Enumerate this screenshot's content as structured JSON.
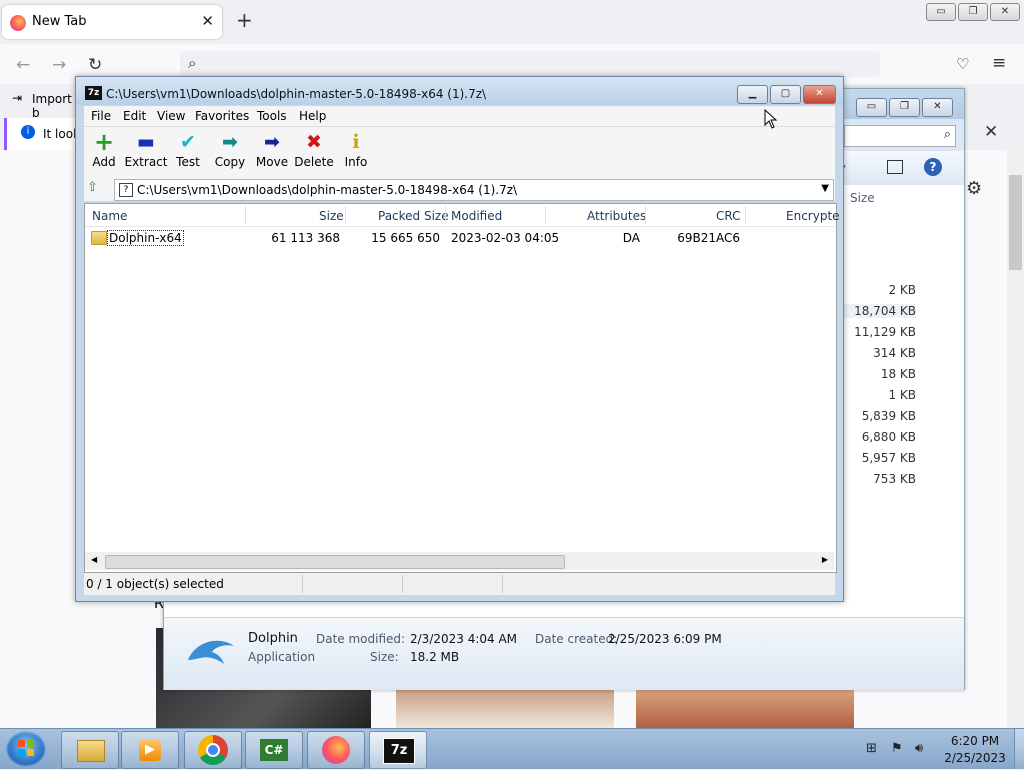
{
  "browser": {
    "tab_title": "New Tab",
    "tab_close": "✕",
    "new_tab": "+",
    "import_label": "Import b",
    "notice_text": "It look",
    "window_controls": {
      "minimize": "▭",
      "restore": "❐",
      "close": "✕"
    }
  },
  "explorer": {
    "column_size": "Size",
    "sizes": [
      "2 KB",
      "18,704 KB",
      "11,129 KB",
      "314 KB",
      "18 KB",
      "1 KB",
      "5,839 KB",
      "6,880 KB",
      "5,957 KB",
      "753 KB"
    ],
    "details": {
      "name": "Dolphin",
      "type": "Application",
      "date_modified_label": "Date modified:",
      "date_modified": "2/3/2023 4:04 AM",
      "size_label": "Size:",
      "size": "18.2 MB",
      "date_created_label": "Date created:",
      "date_created": "2/25/2023 6:09 PM"
    },
    "partial_letter": "R"
  },
  "sevenzip": {
    "title": "C:\\Users\\vm1\\Downloads\\dolphin-master-5.0-18498-x64 (1).7z\\",
    "icon_text": "7z",
    "menu": [
      "File",
      "Edit",
      "View",
      "Favorites",
      "Tools",
      "Help"
    ],
    "toolbar": [
      {
        "label": "Add",
        "icon": "+",
        "color": "#1fa31f"
      },
      {
        "label": "Extract",
        "icon": "▬",
        "color": "#1a2fb5"
      },
      {
        "label": "Test",
        "icon": "✔",
        "color": "#19b5c9"
      },
      {
        "label": "Copy",
        "icon": "➡",
        "color": "#138a8a"
      },
      {
        "label": "Move",
        "icon": "➡",
        "color": "#1a2390"
      },
      {
        "label": "Delete",
        "icon": "✖",
        "color": "#d01818"
      },
      {
        "label": "Info",
        "icon": "i",
        "color": "#c9a400"
      }
    ],
    "path": "C:\\Users\\vm1\\Downloads\\dolphin-master-5.0-18498-x64 (1).7z\\",
    "columns": [
      "Name",
      "Size",
      "Packed Size",
      "Modified",
      "Attributes",
      "CRC",
      "Encrypte"
    ],
    "rows": [
      {
        "name": "Dolphin-x64",
        "size": "61 113 368",
        "packed": "15 665 650",
        "modified": "2023-02-03 04:05",
        "attributes": "DA",
        "crc": "69B21AC6"
      }
    ],
    "status": "0 / 1 object(s) selected"
  },
  "taskbar": {
    "time": "6:20 PM",
    "date": "2/25/2023",
    "items": [
      "explorer",
      "media-player",
      "chrome",
      "csharp",
      "firefox",
      "7zip"
    ],
    "csharp_label": "C#",
    "sevenzip_label": "7z"
  }
}
